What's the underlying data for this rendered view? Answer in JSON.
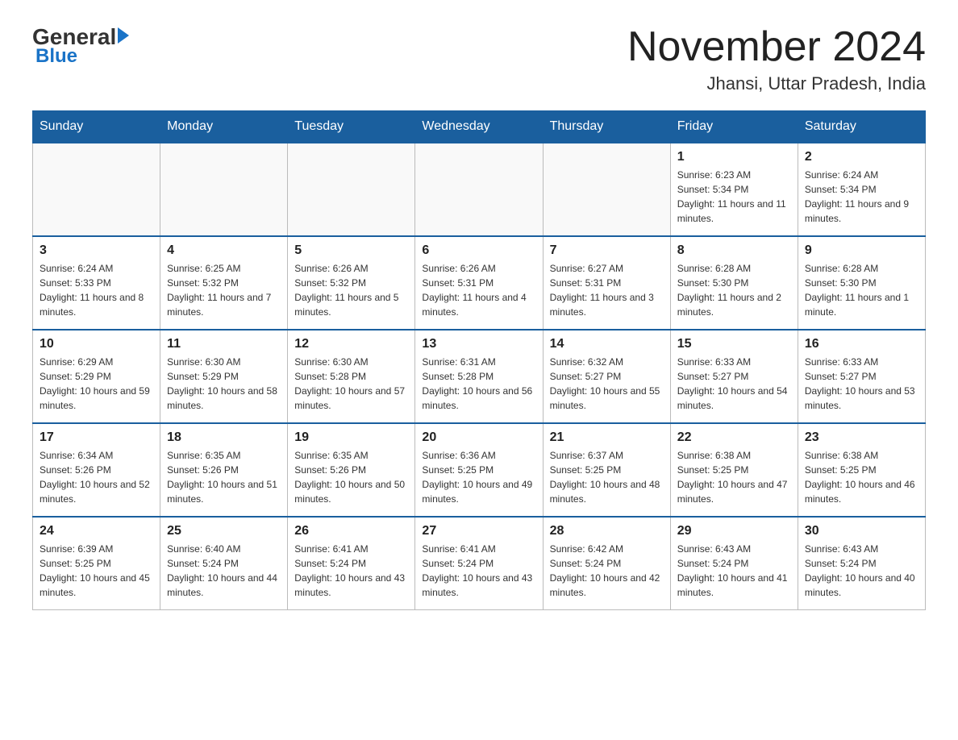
{
  "header": {
    "logo_general": "General",
    "logo_blue": "Blue",
    "month_title": "November 2024",
    "location": "Jhansi, Uttar Pradesh, India"
  },
  "days_of_week": [
    "Sunday",
    "Monday",
    "Tuesday",
    "Wednesday",
    "Thursday",
    "Friday",
    "Saturday"
  ],
  "weeks": [
    [
      {
        "day": "",
        "info": ""
      },
      {
        "day": "",
        "info": ""
      },
      {
        "day": "",
        "info": ""
      },
      {
        "day": "",
        "info": ""
      },
      {
        "day": "",
        "info": ""
      },
      {
        "day": "1",
        "info": "Sunrise: 6:23 AM\nSunset: 5:34 PM\nDaylight: 11 hours and 11 minutes."
      },
      {
        "day": "2",
        "info": "Sunrise: 6:24 AM\nSunset: 5:34 PM\nDaylight: 11 hours and 9 minutes."
      }
    ],
    [
      {
        "day": "3",
        "info": "Sunrise: 6:24 AM\nSunset: 5:33 PM\nDaylight: 11 hours and 8 minutes."
      },
      {
        "day": "4",
        "info": "Sunrise: 6:25 AM\nSunset: 5:32 PM\nDaylight: 11 hours and 7 minutes."
      },
      {
        "day": "5",
        "info": "Sunrise: 6:26 AM\nSunset: 5:32 PM\nDaylight: 11 hours and 5 minutes."
      },
      {
        "day": "6",
        "info": "Sunrise: 6:26 AM\nSunset: 5:31 PM\nDaylight: 11 hours and 4 minutes."
      },
      {
        "day": "7",
        "info": "Sunrise: 6:27 AM\nSunset: 5:31 PM\nDaylight: 11 hours and 3 minutes."
      },
      {
        "day": "8",
        "info": "Sunrise: 6:28 AM\nSunset: 5:30 PM\nDaylight: 11 hours and 2 minutes."
      },
      {
        "day": "9",
        "info": "Sunrise: 6:28 AM\nSunset: 5:30 PM\nDaylight: 11 hours and 1 minute."
      }
    ],
    [
      {
        "day": "10",
        "info": "Sunrise: 6:29 AM\nSunset: 5:29 PM\nDaylight: 10 hours and 59 minutes."
      },
      {
        "day": "11",
        "info": "Sunrise: 6:30 AM\nSunset: 5:29 PM\nDaylight: 10 hours and 58 minutes."
      },
      {
        "day": "12",
        "info": "Sunrise: 6:30 AM\nSunset: 5:28 PM\nDaylight: 10 hours and 57 minutes."
      },
      {
        "day": "13",
        "info": "Sunrise: 6:31 AM\nSunset: 5:28 PM\nDaylight: 10 hours and 56 minutes."
      },
      {
        "day": "14",
        "info": "Sunrise: 6:32 AM\nSunset: 5:27 PM\nDaylight: 10 hours and 55 minutes."
      },
      {
        "day": "15",
        "info": "Sunrise: 6:33 AM\nSunset: 5:27 PM\nDaylight: 10 hours and 54 minutes."
      },
      {
        "day": "16",
        "info": "Sunrise: 6:33 AM\nSunset: 5:27 PM\nDaylight: 10 hours and 53 minutes."
      }
    ],
    [
      {
        "day": "17",
        "info": "Sunrise: 6:34 AM\nSunset: 5:26 PM\nDaylight: 10 hours and 52 minutes."
      },
      {
        "day": "18",
        "info": "Sunrise: 6:35 AM\nSunset: 5:26 PM\nDaylight: 10 hours and 51 minutes."
      },
      {
        "day": "19",
        "info": "Sunrise: 6:35 AM\nSunset: 5:26 PM\nDaylight: 10 hours and 50 minutes."
      },
      {
        "day": "20",
        "info": "Sunrise: 6:36 AM\nSunset: 5:25 PM\nDaylight: 10 hours and 49 minutes."
      },
      {
        "day": "21",
        "info": "Sunrise: 6:37 AM\nSunset: 5:25 PM\nDaylight: 10 hours and 48 minutes."
      },
      {
        "day": "22",
        "info": "Sunrise: 6:38 AM\nSunset: 5:25 PM\nDaylight: 10 hours and 47 minutes."
      },
      {
        "day": "23",
        "info": "Sunrise: 6:38 AM\nSunset: 5:25 PM\nDaylight: 10 hours and 46 minutes."
      }
    ],
    [
      {
        "day": "24",
        "info": "Sunrise: 6:39 AM\nSunset: 5:25 PM\nDaylight: 10 hours and 45 minutes."
      },
      {
        "day": "25",
        "info": "Sunrise: 6:40 AM\nSunset: 5:24 PM\nDaylight: 10 hours and 44 minutes."
      },
      {
        "day": "26",
        "info": "Sunrise: 6:41 AM\nSunset: 5:24 PM\nDaylight: 10 hours and 43 minutes."
      },
      {
        "day": "27",
        "info": "Sunrise: 6:41 AM\nSunset: 5:24 PM\nDaylight: 10 hours and 43 minutes."
      },
      {
        "day": "28",
        "info": "Sunrise: 6:42 AM\nSunset: 5:24 PM\nDaylight: 10 hours and 42 minutes."
      },
      {
        "day": "29",
        "info": "Sunrise: 6:43 AM\nSunset: 5:24 PM\nDaylight: 10 hours and 41 minutes."
      },
      {
        "day": "30",
        "info": "Sunrise: 6:43 AM\nSunset: 5:24 PM\nDaylight: 10 hours and 40 minutes."
      }
    ]
  ]
}
